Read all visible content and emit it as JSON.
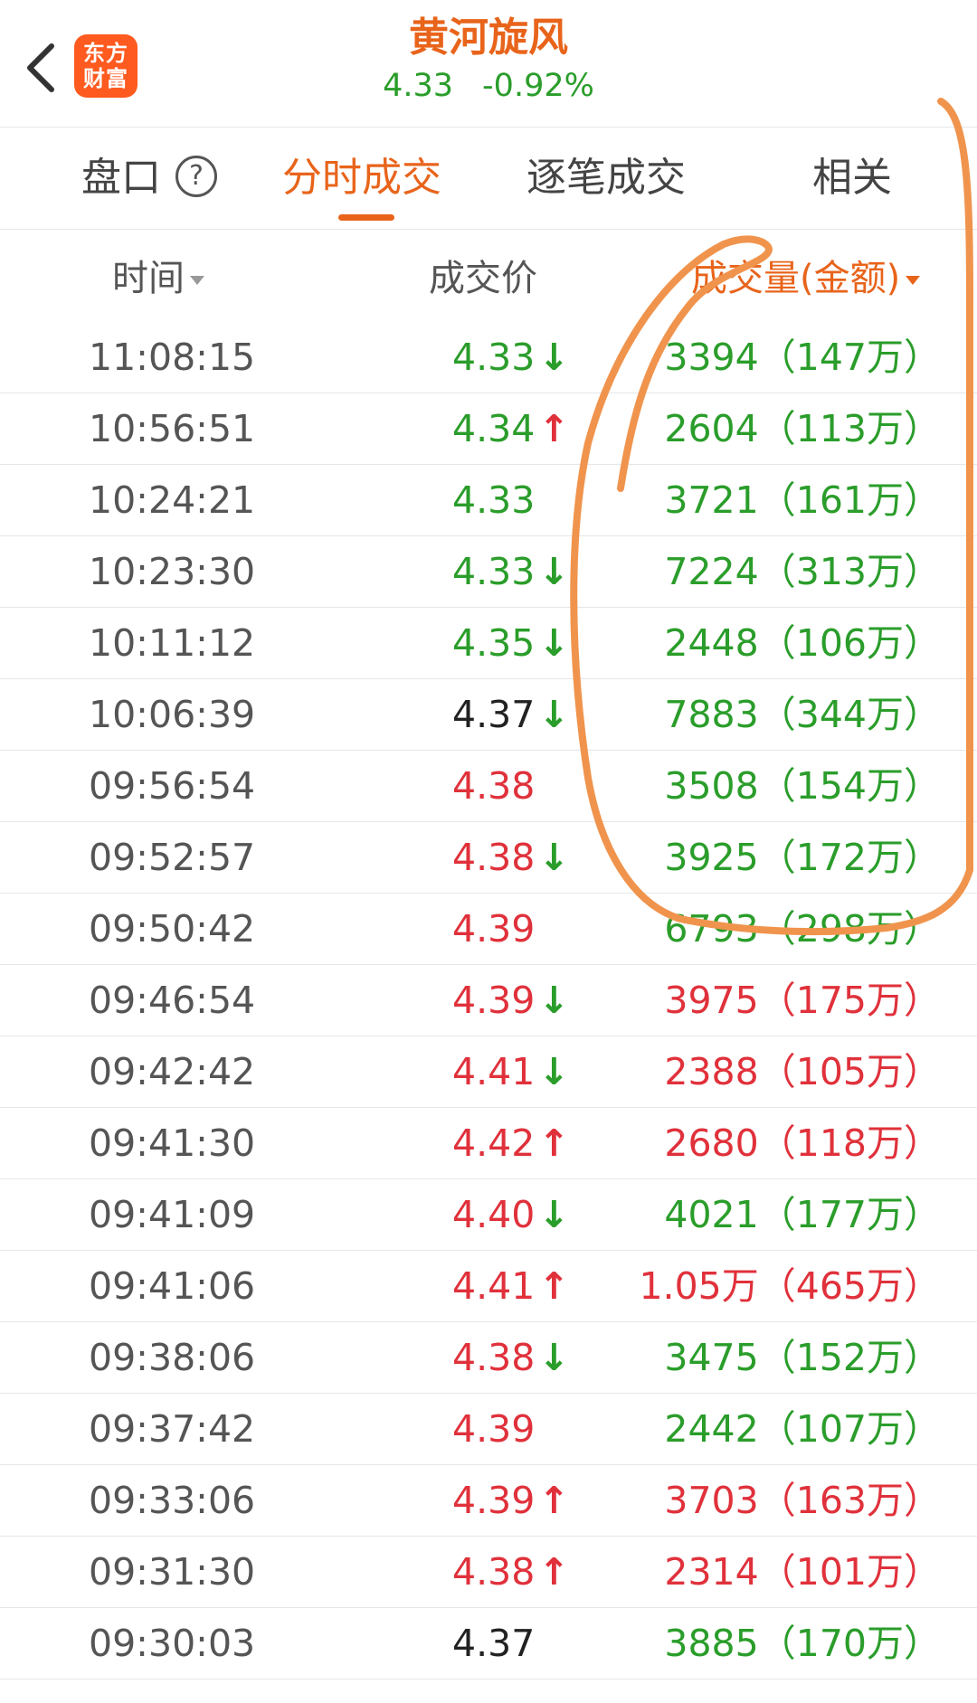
{
  "header": {
    "back_icon": "chevron-left-icon",
    "logo_line1": "东方",
    "logo_line2": "财富",
    "stock_name": "黄河旋风",
    "price": "4.33",
    "change_pct": "-0.92%"
  },
  "tabs": [
    {
      "label": "盘口",
      "active": false,
      "icon": "help-circle-icon",
      "icon_text": "?"
    },
    {
      "label": "分时成交",
      "active": true
    },
    {
      "label": "逐笔成交",
      "active": false
    },
    {
      "label": "相关",
      "active": false
    }
  ],
  "columns": {
    "time": "时间",
    "price": "成交价",
    "volume": "成交量(金额)"
  },
  "colors": {
    "accent": "#e8641b",
    "up": "#e0313b",
    "down": "#2a9d2a",
    "annotation": "#f0944d"
  },
  "rows": [
    {
      "time": "11:08:15",
      "price": "4.33",
      "price_color": "green",
      "arrow": "down",
      "volume": "3394（147万）",
      "volume_color": "green"
    },
    {
      "time": "10:56:51",
      "price": "4.34",
      "price_color": "green",
      "arrow": "up",
      "volume": "2604（113万）",
      "volume_color": "green"
    },
    {
      "time": "10:24:21",
      "price": "4.33",
      "price_color": "green",
      "arrow": "",
      "volume": "3721（161万）",
      "volume_color": "green"
    },
    {
      "time": "10:23:30",
      "price": "4.33",
      "price_color": "green",
      "arrow": "down",
      "volume": "7224（313万）",
      "volume_color": "green"
    },
    {
      "time": "10:11:12",
      "price": "4.35",
      "price_color": "green",
      "arrow": "down",
      "volume": "2448（106万）",
      "volume_color": "green"
    },
    {
      "time": "10:06:39",
      "price": "4.37",
      "price_color": "black",
      "arrow": "down",
      "volume": "7883（344万）",
      "volume_color": "green"
    },
    {
      "time": "09:56:54",
      "price": "4.38",
      "price_color": "red",
      "arrow": "",
      "volume": "3508（154万）",
      "volume_color": "green"
    },
    {
      "time": "09:52:57",
      "price": "4.38",
      "price_color": "red",
      "arrow": "down",
      "volume": "3925（172万）",
      "volume_color": "green"
    },
    {
      "time": "09:50:42",
      "price": "4.39",
      "price_color": "red",
      "arrow": "",
      "volume": "6793（298万）",
      "volume_color": "green"
    },
    {
      "time": "09:46:54",
      "price": "4.39",
      "price_color": "red",
      "arrow": "down",
      "volume": "3975（175万）",
      "volume_color": "red"
    },
    {
      "time": "09:42:42",
      "price": "4.41",
      "price_color": "red",
      "arrow": "down",
      "volume": "2388（105万）",
      "volume_color": "red"
    },
    {
      "time": "09:41:30",
      "price": "4.42",
      "price_color": "red",
      "arrow": "up",
      "volume": "2680（118万）",
      "volume_color": "red"
    },
    {
      "time": "09:41:09",
      "price": "4.40",
      "price_color": "red",
      "arrow": "down",
      "volume": "4021（177万）",
      "volume_color": "green"
    },
    {
      "time": "09:41:06",
      "price": "4.41",
      "price_color": "red",
      "arrow": "up",
      "volume": "1.05万（465万）",
      "volume_color": "red"
    },
    {
      "time": "09:38:06",
      "price": "4.38",
      "price_color": "red",
      "arrow": "down",
      "volume": "3475（152万）",
      "volume_color": "green"
    },
    {
      "time": "09:37:42",
      "price": "4.39",
      "price_color": "red",
      "arrow": "",
      "volume": "2442（107万）",
      "volume_color": "green"
    },
    {
      "time": "09:33:06",
      "price": "4.39",
      "price_color": "red",
      "arrow": "up",
      "volume": "3703（163万）",
      "volume_color": "red"
    },
    {
      "time": "09:31:30",
      "price": "4.38",
      "price_color": "red",
      "arrow": "up",
      "volume": "2314（101万）",
      "volume_color": "red"
    },
    {
      "time": "09:30:03",
      "price": "4.37",
      "price_color": "black",
      "arrow": "",
      "volume": "3885（170万）",
      "volume_color": "green"
    }
  ]
}
